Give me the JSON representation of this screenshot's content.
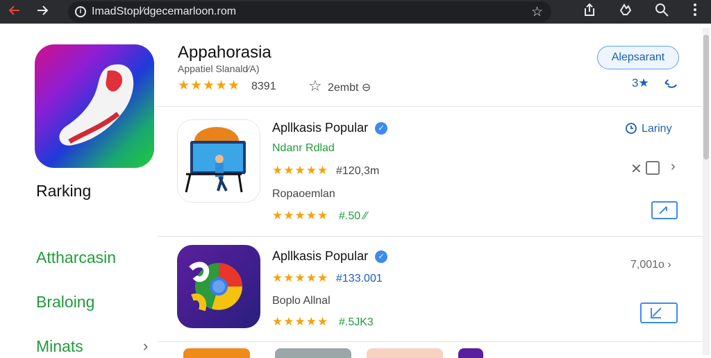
{
  "browser": {
    "url": "ImadStopl⁄dgecemarloon.rom",
    "back_icon": "arrow-left-icon",
    "forward_icon": "arrow-right-icon",
    "info_icon": "i",
    "bookmark_star": "☆"
  },
  "app": {
    "title": "Appahorasia",
    "subtitle": "Appatiel Slanald⁄A)",
    "stars": "★★★★★",
    "rating_count": "8391",
    "wishlist_star": "☆",
    "wishlist_label": "2embt ⊖",
    "install_label": "Alepsarant",
    "count_label": "3★"
  },
  "sidebar": {
    "ranking": "Rarking",
    "links": [
      "Attharcasin",
      "Braloing",
      "Minats"
    ],
    "chevron": "›"
  },
  "cards": [
    {
      "title": "Apllkasis Popular",
      "verified": "✓",
      "developer": "Ndanr Rdlad",
      "stars": "★★★★★",
      "count": "#120,3m",
      "category": "Ropaoemlan",
      "stars2": "★★★★★",
      "price": "#.50 ⁄⁄",
      "right_top": "Lariny",
      "right_mid": "✕",
      "right_chevron": "›"
    },
    {
      "title": "Apllkasis Popular",
      "verified": "✓",
      "stars": "★★★★★",
      "count": "#133.001",
      "category": "Boplo Allnal",
      "stars2": "★★★★★",
      "price": "#.5JK3",
      "right_top": "7,001o ›"
    }
  ],
  "colors": {
    "accent_blue": "#1a5fb4",
    "green": "#1f9d3a",
    "star": "#f5a30b"
  }
}
